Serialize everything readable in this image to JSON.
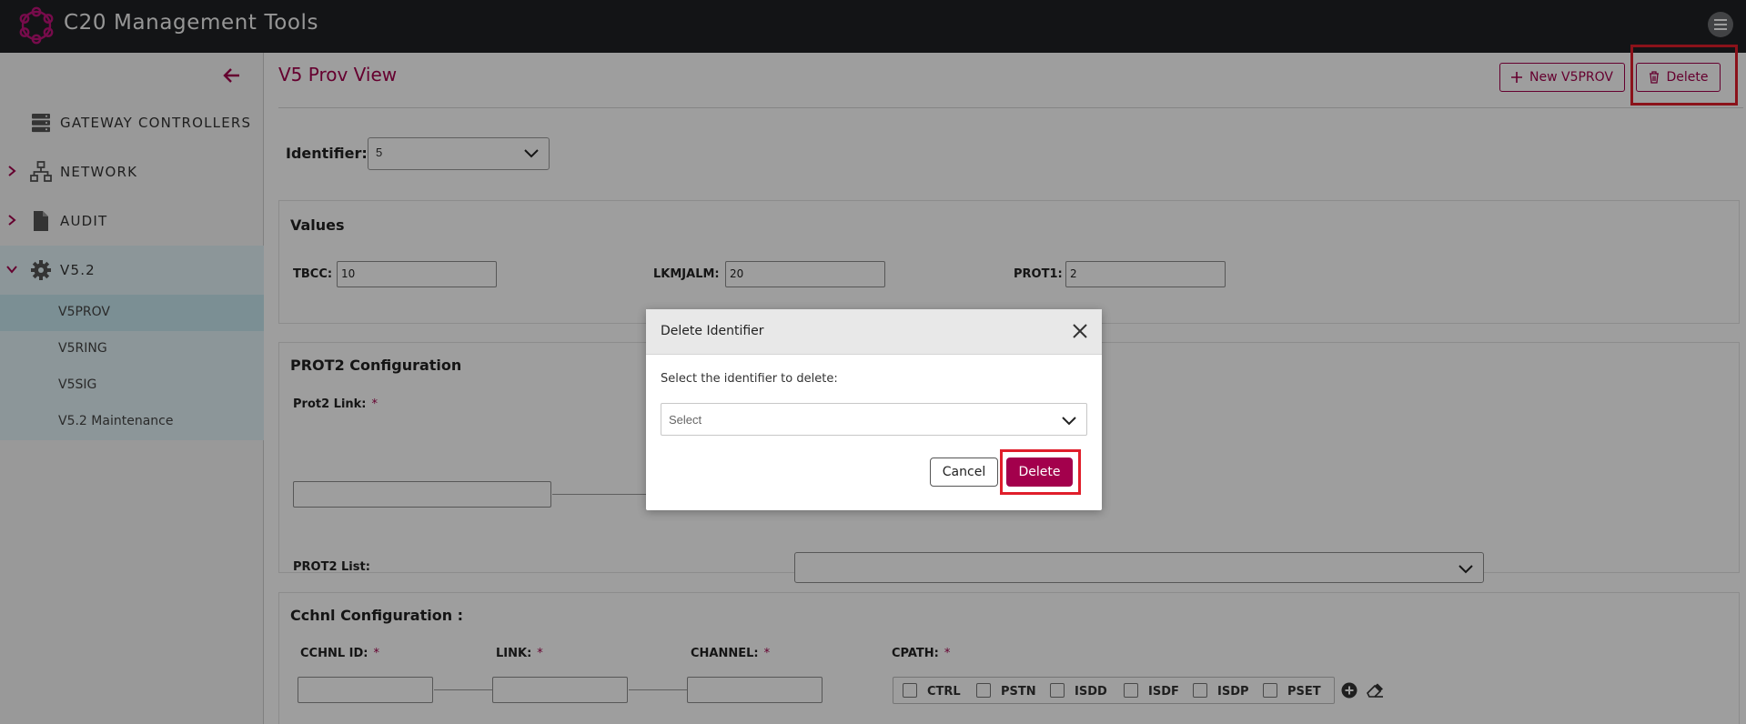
{
  "app": {
    "title": "C20 Management Tools"
  },
  "colors": {
    "brand": "#a3004c",
    "topbar": "#1f2124",
    "highlight": "#e01e2b"
  },
  "sidebar": {
    "items": [
      {
        "label": "GATEWAY CONTROLLERS",
        "icon": "server-icon"
      },
      {
        "label": "NETWORK",
        "icon": "network-icon"
      },
      {
        "label": "AUDIT",
        "icon": "document-icon"
      },
      {
        "label": "V5.2",
        "icon": "gear-icon"
      }
    ],
    "subitems": [
      {
        "label": "V5PROV",
        "active": true
      },
      {
        "label": "V5RING"
      },
      {
        "label": "V5SIG"
      },
      {
        "label": "V5.2 Maintenance"
      }
    ]
  },
  "page": {
    "title": "V5 Prov View",
    "new_button": "New V5PROV",
    "delete_button": "Delete",
    "identifier_label": "Identifier:",
    "identifier_value": "5"
  },
  "values_panel": {
    "title": "Values",
    "fields": [
      {
        "label": "TBCC:",
        "value": "10"
      },
      {
        "label": "LKMJALM:",
        "value": "20"
      },
      {
        "label": "PROT1:",
        "value": "2"
      }
    ]
  },
  "prot2_panel": {
    "title": "PROT2 Configuration",
    "link_label": "Prot2 Link:",
    "required_mark": "*",
    "list_label": "PROT2 List:"
  },
  "cchnl_panel": {
    "title": "Cchnl Configuration :",
    "fields": [
      "CCHNL ID:",
      "LINK:",
      "CHANNEL:",
      "CPATH:"
    ],
    "cpath_options": [
      "CTRL",
      "PSTN",
      "ISDD",
      "ISDF",
      "ISDP",
      "PSET"
    ]
  },
  "modal": {
    "title": "Delete Identifier",
    "prompt": "Select the identifier to delete:",
    "select_placeholder": "Select",
    "cancel_label": "Cancel",
    "delete_label": "Delete"
  }
}
